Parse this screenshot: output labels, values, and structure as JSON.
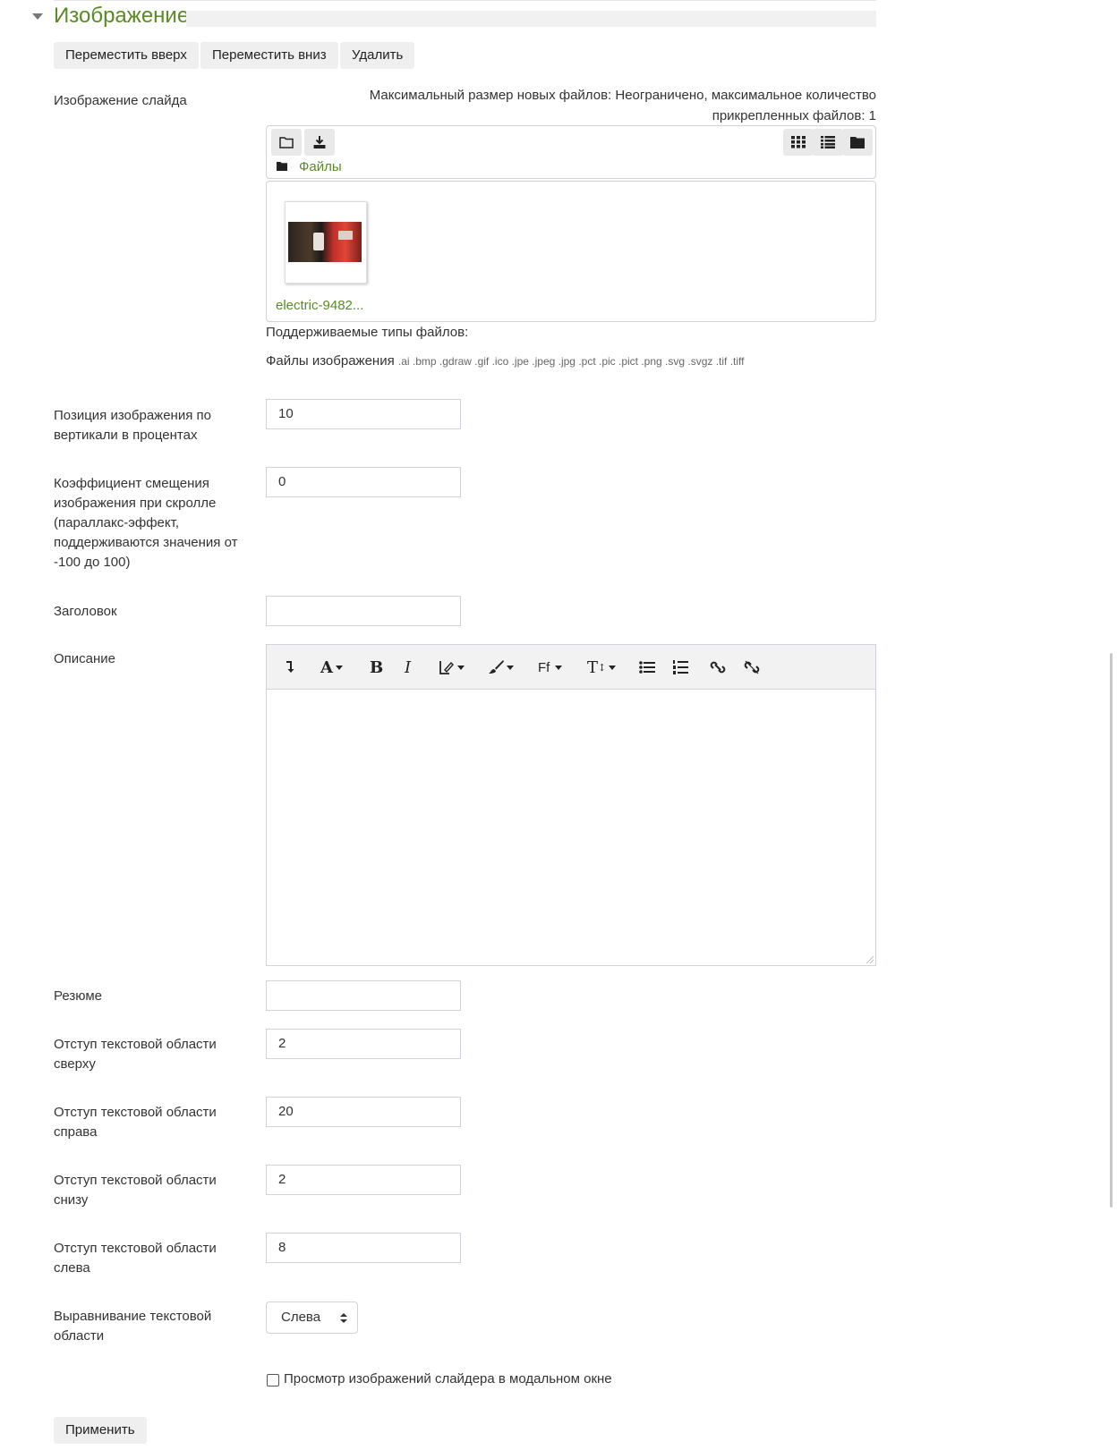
{
  "section": {
    "title": "Изображение"
  },
  "actions": {
    "move_up": "Переместить вверх",
    "move_down": "Переместить вниз",
    "delete": "Удалить"
  },
  "slide_image": {
    "label": "Изображение слайда",
    "limits_line1": "Максимальный размер новых файлов: Неограничено, максимальное количество",
    "limits_line2": "прикрепленных файлов: 1",
    "breadcrumb": "Файлы",
    "file_name": "electric-9482...",
    "supported_title": "Поддерживаемые типы файлов:",
    "supported_group": "Файлы изображения",
    "supported_ext": ".ai .bmp .gdraw .gif .ico .jpe .jpeg .jpg .pct .pic .pict .png .svg .svgz .tif .tiff",
    "icons": [
      "folder-open-icon",
      "download-icon",
      "grid-view-icon",
      "list-view-icon",
      "folder-view-icon"
    ]
  },
  "fields": {
    "vpos": {
      "label_l1": "Позиция изображения по",
      "label_l2": "вертикали в процентах",
      "value": "10"
    },
    "parallax": {
      "label_l1": "Коэффициент смещения",
      "label_l2": "изображения при скролле",
      "label_l3": "(параллакс-эффект,",
      "label_l4": "поддерживаются значения от",
      "label_l5": "-100 до 100)",
      "value": "0"
    },
    "heading": {
      "label": "Заголовок",
      "value": ""
    },
    "description": {
      "label": "Описание"
    },
    "summary": {
      "label": "Резюме",
      "value": ""
    },
    "pad_top": {
      "label_l1": "Отступ текстовой области",
      "label_l2": "сверху",
      "value": "2"
    },
    "pad_right": {
      "label_l1": "Отступ текстовой области",
      "label_l2": "справа",
      "value": "20"
    },
    "pad_bottom": {
      "label_l1": "Отступ текстовой области",
      "label_l2": "снизу",
      "value": "2"
    },
    "pad_left": {
      "label_l1": "Отступ текстовой области",
      "label_l2": "слева",
      "value": "8"
    },
    "align": {
      "label_l1": "Выравнивание текстовой",
      "label_l2": "области",
      "value": "Слева"
    }
  },
  "editor_toolbar": {
    "bold": "B",
    "italic": "I",
    "font_color": "A",
    "font_family": "Ff",
    "font_size": "T",
    "icons": [
      "collapse-icon",
      "font-color-icon",
      "bold-icon",
      "italic-icon",
      "style-icon",
      "brush-icon",
      "font-family-icon",
      "font-size-icon",
      "bullet-list-icon",
      "numbered-list-icon",
      "link-icon",
      "unlink-icon"
    ]
  },
  "modal_checkbox": {
    "label": "Просмотр изображений слайдера в модальном окне",
    "checked": false
  },
  "apply_button": "Применить"
}
